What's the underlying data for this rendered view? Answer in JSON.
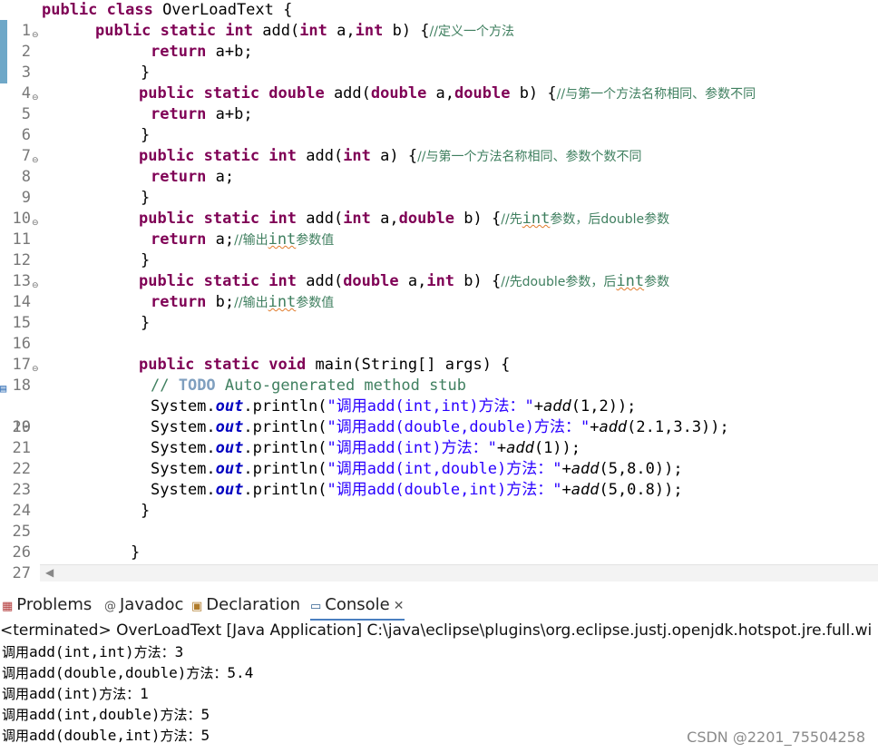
{
  "editor": {
    "line_numbers": [
      "1",
      "2",
      "3",
      "4",
      "5",
      "6",
      "7",
      "8",
      "9",
      "10",
      "11",
      "12",
      "13",
      "14",
      "15",
      "16",
      "17",
      "18",
      "19",
      "20",
      "21",
      "22",
      "23",
      "24",
      "25",
      "26",
      "27"
    ],
    "l1": {
      "k1": "public class",
      "t1": " OverLoadText {"
    },
    "l2": {
      "k1": "public static int",
      "t1": " add(",
      "k2": "int",
      "t2": " a,",
      "k3": "int",
      "t3": " b) {",
      "c": "//定义一个方法"
    },
    "l3": {
      "k1": "return",
      "t1": " a+b;"
    },
    "l4": {
      "t1": "}"
    },
    "l5": {
      "k1": "public static double",
      "t1": " add(",
      "k2": "double",
      "t2": " a,",
      "k3": "double",
      "t3": " b) {",
      "c": "//与第一个方法名称相同、参数不同"
    },
    "l6": {
      "k1": "return",
      "t1": " a+b;"
    },
    "l7": {
      "t1": "}"
    },
    "l8": {
      "k1": "public static int",
      "t1": " add(",
      "k2": "int",
      "t2": " a) {",
      "c": "//与第一个方法名称相同、参数个数不同"
    },
    "l9": {
      "k1": "return",
      "t1": " a;"
    },
    "l10": {
      "t1": "}"
    },
    "l11": {
      "k1": "public static int",
      "t1": " add(",
      "k2": "int",
      "t2": " a,",
      "k3": "double",
      "t3": " b) {",
      "c1": "//先",
      "c2": "int",
      "c3": "参数，后double参数"
    },
    "l12": {
      "k1": "return",
      "t1": " a;",
      "c1": "//输出",
      "c2": "int",
      "c3": "参数值"
    },
    "l13": {
      "t1": "}"
    },
    "l14": {
      "k1": "public static int",
      "t1": " add(",
      "k2": "double",
      "t2": " a,",
      "k3": "int",
      "t3": " b) {",
      "c1": "//先double参数，后",
      "c2": "int",
      "c3": "参数"
    },
    "l15": {
      "k1": "return",
      "t1": " b;",
      "c1": "//输出",
      "c2": "int",
      "c3": "参数值"
    },
    "l16": {
      "t1": "}"
    },
    "l18": {
      "k1": "public static void",
      "t1": " main(String[] args) {"
    },
    "l19": {
      "c1": "// ",
      "todo": "TODO",
      "c2": " Auto-generated method stub"
    },
    "l20": {
      "p1": "System.",
      "f": "out",
      "p2": ".println(",
      "s": "\"调用add(int,int)方法：\"",
      "p3": "+",
      "m": "add",
      "p4": "(1,2));"
    },
    "l21": {
      "p1": "System.",
      "f": "out",
      "p2": ".println(",
      "s": "\"调用add(double,double)方法：\"",
      "p3": "+",
      "m": "add",
      "p4": "(2.1,3.3));"
    },
    "l22": {
      "p1": "System.",
      "f": "out",
      "p2": ".println(",
      "s": "\"调用add(int)方法：\"",
      "p3": "+",
      "m": "add",
      "p4": "(1));"
    },
    "l23": {
      "p1": "System.",
      "f": "out",
      "p2": ".println(",
      "s": "\"调用add(int,double)方法：\"",
      "p3": "+",
      "m": "add",
      "p4": "(5,8.0));"
    },
    "l24": {
      "p1": "System.",
      "f": "out",
      "p2": ".println(",
      "s": "\"调用add(double,int)方法：\"",
      "p3": "+",
      "m": "add",
      "p4": "(5,0.8));"
    },
    "l25": {
      "t1": "}"
    },
    "l27": {
      "t1": "}"
    }
  },
  "tabs": [
    {
      "label": "Problems",
      "icon": "problems-icon"
    },
    {
      "label": "Javadoc",
      "icon": "at-icon"
    },
    {
      "label": "Declaration",
      "icon": "declaration-icon"
    },
    {
      "label": "Console",
      "icon": "console-icon"
    }
  ],
  "console": {
    "header": "<terminated> OverLoadText [Java Application] C:\\java\\eclipse\\plugins\\org.eclipse.justj.openjdk.hotspot.jre.full.wi",
    "output": [
      {
        "a": "调用",
        "b": "add(int,int)",
        "c": "方法：",
        "d": "3"
      },
      {
        "a": "调用",
        "b": "add(double,double)",
        "c": "方法：",
        "d": "5.4"
      },
      {
        "a": "调用",
        "b": "add(int)",
        "c": "方法：",
        "d": "1"
      },
      {
        "a": "调用",
        "b": "add(int,double)",
        "c": "方法：",
        "d": "5"
      },
      {
        "a": "调用",
        "b": "add(double,int)",
        "c": "方法：",
        "d": "5"
      }
    ]
  },
  "watermark": "CSDN @2201_75504258"
}
